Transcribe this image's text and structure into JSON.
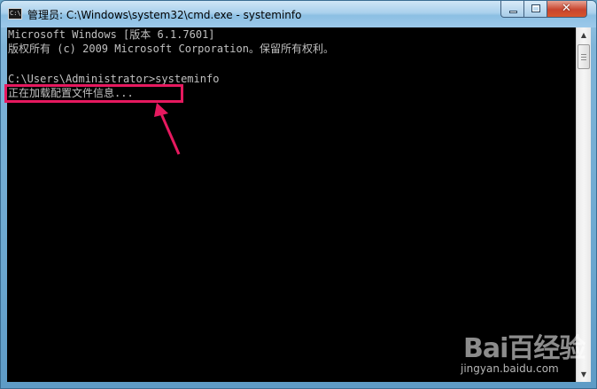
{
  "window": {
    "title": "管理员: C:\\Windows\\system32\\cmd.exe - systeminfo",
    "icon": "cmd-icon",
    "icon_text": "C:\\"
  },
  "controls": {
    "minimize_icon": "minimize-icon",
    "maximize_icon": "maximize-icon",
    "close_icon": "close-icon",
    "close_glyph": "✕"
  },
  "console": {
    "lines": [
      "Microsoft Windows [版本 6.1.7601]",
      "版权所有 (c) 2009 Microsoft Corporation。保留所有权利。",
      "",
      "C:\\Users\\Administrator>systeminfo",
      "正在加载配置文件信息..."
    ],
    "text_color": "#c0c0c0",
    "background": "#000000"
  },
  "annotation": {
    "highlight_color": "#e6195f"
  },
  "watermark": {
    "brand": "Bai百经验",
    "url": "jingyan.baidu.com"
  }
}
